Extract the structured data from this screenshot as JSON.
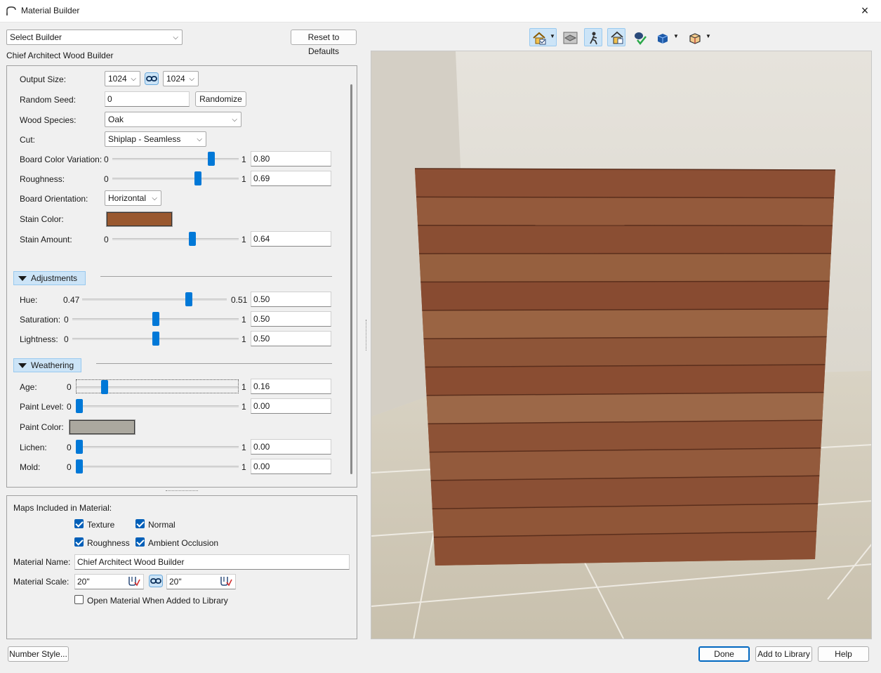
{
  "window": {
    "title": "Material Builder",
    "close_icon": "×"
  },
  "builder_select": {
    "value": "Select Builder"
  },
  "reset_button": "Reset to Defaults",
  "builder_name": "Chief Architect Wood Builder",
  "properties": {
    "output_size_label": "Output Size:",
    "output_width": "1024",
    "output_height": "1024",
    "random_seed_label": "Random Seed:",
    "random_seed": "0",
    "randomize_label": "Randomize",
    "wood_species_label": "Wood Species:",
    "wood_species": "Oak",
    "cut_label": "Cut:",
    "cut": "Shiplap - Seamless",
    "board_color_variation": {
      "label": "Board Color Variation:",
      "min": "0",
      "max": "1",
      "value": "0.80",
      "level": 0.8
    },
    "roughness": {
      "label": "Roughness:",
      "min": "0",
      "max": "1",
      "value": "0.69",
      "level": 0.69
    },
    "board_orientation_label": "Board Orientation:",
    "board_orientation": "Horizontal",
    "stain_color_label": "Stain Color:",
    "stain_color": "#99582f",
    "stain_amount": {
      "label": "Stain Amount:",
      "min": "0",
      "max": "1",
      "value": "0.64",
      "level": 0.64
    }
  },
  "adjustments": {
    "header": "Adjustments",
    "hue": {
      "label": "Hue:",
      "min": "0.47",
      "max": "0.51",
      "value": "0.50",
      "level": 0.75
    },
    "saturation": {
      "label": "Saturation:",
      "min": "0",
      "max": "1",
      "value": "0.50",
      "level": 0.5
    },
    "lightness": {
      "label": "Lightness:",
      "min": "0",
      "max": "1",
      "value": "0.50",
      "level": 0.5
    }
  },
  "weathering": {
    "header": "Weathering",
    "age": {
      "label": "Age:",
      "min": "0",
      "max": "1",
      "value": "0.16",
      "level": 0.16
    },
    "paint_level": {
      "label": "Paint Level:",
      "min": "0",
      "max": "1",
      "value": "0.00",
      "level": 0
    },
    "paint_color_label": "Paint Color:",
    "paint_color": "#aba89f",
    "lichen": {
      "label": "Lichen:",
      "min": "0",
      "max": "1",
      "value": "0.00",
      "level": 0
    },
    "mold": {
      "label": "Mold:",
      "min": "0",
      "max": "1",
      "value": "0.00",
      "level": 0
    }
  },
  "maps": {
    "header": "Maps Included in Material:",
    "texture": {
      "label": "Texture",
      "checked": true
    },
    "normal": {
      "label": "Normal",
      "checked": true
    },
    "roughness": {
      "label": "Roughness",
      "checked": true
    },
    "ambient_occlusion": {
      "label": "Ambient Occlusion",
      "checked": true
    },
    "material_name_label": "Material Name:",
    "material_name": "Chief Architect Wood Builder",
    "material_scale_label": "Material Scale:",
    "scale_width": "20\"",
    "scale_height": "20\"",
    "open_when_added": {
      "label": "Open Material When Added to Library",
      "checked": false
    }
  },
  "footer": {
    "number_style": "Number Style...",
    "done": "Done",
    "add_to_library": "Add to Library",
    "help": "Help"
  },
  "preview": {
    "toolbar_icons": [
      "house-view-icon",
      "material-layer-icon",
      "walkthrough-icon",
      "house-check-icon",
      "accept-checkmark-icon",
      "cube-view-icon",
      "box-outline-icon"
    ],
    "wood_color": "#8e5136",
    "floor_color": "#cdc6b6",
    "wall_color": "#ddd9cf"
  }
}
